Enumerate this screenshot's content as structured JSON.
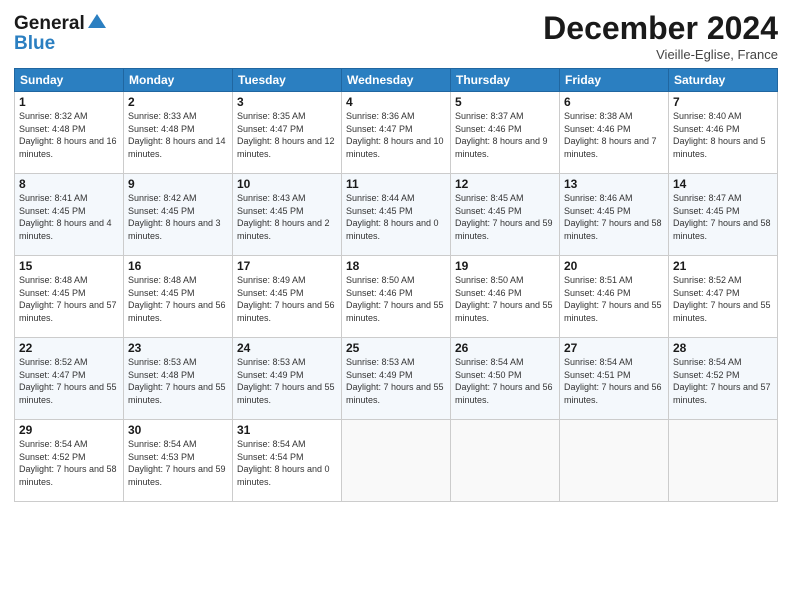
{
  "header": {
    "logo_general": "General",
    "logo_blue": "Blue",
    "month": "December 2024",
    "location": "Vieille-Eglise, France"
  },
  "days_of_week": [
    "Sunday",
    "Monday",
    "Tuesday",
    "Wednesday",
    "Thursday",
    "Friday",
    "Saturday"
  ],
  "weeks": [
    [
      {
        "day": "1",
        "sunrise": "8:32 AM",
        "sunset": "4:48 PM",
        "daylight": "8 hours and 16 minutes."
      },
      {
        "day": "2",
        "sunrise": "8:33 AM",
        "sunset": "4:48 PM",
        "daylight": "8 hours and 14 minutes."
      },
      {
        "day": "3",
        "sunrise": "8:35 AM",
        "sunset": "4:47 PM",
        "daylight": "8 hours and 12 minutes."
      },
      {
        "day": "4",
        "sunrise": "8:36 AM",
        "sunset": "4:47 PM",
        "daylight": "8 hours and 10 minutes."
      },
      {
        "day": "5",
        "sunrise": "8:37 AM",
        "sunset": "4:46 PM",
        "daylight": "8 hours and 9 minutes."
      },
      {
        "day": "6",
        "sunrise": "8:38 AM",
        "sunset": "4:46 PM",
        "daylight": "8 hours and 7 minutes."
      },
      {
        "day": "7",
        "sunrise": "8:40 AM",
        "sunset": "4:46 PM",
        "daylight": "8 hours and 5 minutes."
      }
    ],
    [
      {
        "day": "8",
        "sunrise": "8:41 AM",
        "sunset": "4:45 PM",
        "daylight": "8 hours and 4 minutes."
      },
      {
        "day": "9",
        "sunrise": "8:42 AM",
        "sunset": "4:45 PM",
        "daylight": "8 hours and 3 minutes."
      },
      {
        "day": "10",
        "sunrise": "8:43 AM",
        "sunset": "4:45 PM",
        "daylight": "8 hours and 2 minutes."
      },
      {
        "day": "11",
        "sunrise": "8:44 AM",
        "sunset": "4:45 PM",
        "daylight": "8 hours and 0 minutes."
      },
      {
        "day": "12",
        "sunrise": "8:45 AM",
        "sunset": "4:45 PM",
        "daylight": "7 hours and 59 minutes."
      },
      {
        "day": "13",
        "sunrise": "8:46 AM",
        "sunset": "4:45 PM",
        "daylight": "7 hours and 58 minutes."
      },
      {
        "day": "14",
        "sunrise": "8:47 AM",
        "sunset": "4:45 PM",
        "daylight": "7 hours and 58 minutes."
      }
    ],
    [
      {
        "day": "15",
        "sunrise": "8:48 AM",
        "sunset": "4:45 PM",
        "daylight": "7 hours and 57 minutes."
      },
      {
        "day": "16",
        "sunrise": "8:48 AM",
        "sunset": "4:45 PM",
        "daylight": "7 hours and 56 minutes."
      },
      {
        "day": "17",
        "sunrise": "8:49 AM",
        "sunset": "4:45 PM",
        "daylight": "7 hours and 56 minutes."
      },
      {
        "day": "18",
        "sunrise": "8:50 AM",
        "sunset": "4:46 PM",
        "daylight": "7 hours and 55 minutes."
      },
      {
        "day": "19",
        "sunrise": "8:50 AM",
        "sunset": "4:46 PM",
        "daylight": "7 hours and 55 minutes."
      },
      {
        "day": "20",
        "sunrise": "8:51 AM",
        "sunset": "4:46 PM",
        "daylight": "7 hours and 55 minutes."
      },
      {
        "day": "21",
        "sunrise": "8:52 AM",
        "sunset": "4:47 PM",
        "daylight": "7 hours and 55 minutes."
      }
    ],
    [
      {
        "day": "22",
        "sunrise": "8:52 AM",
        "sunset": "4:47 PM",
        "daylight": "7 hours and 55 minutes."
      },
      {
        "day": "23",
        "sunrise": "8:53 AM",
        "sunset": "4:48 PM",
        "daylight": "7 hours and 55 minutes."
      },
      {
        "day": "24",
        "sunrise": "8:53 AM",
        "sunset": "4:49 PM",
        "daylight": "7 hours and 55 minutes."
      },
      {
        "day": "25",
        "sunrise": "8:53 AM",
        "sunset": "4:49 PM",
        "daylight": "7 hours and 55 minutes."
      },
      {
        "day": "26",
        "sunrise": "8:54 AM",
        "sunset": "4:50 PM",
        "daylight": "7 hours and 56 minutes."
      },
      {
        "day": "27",
        "sunrise": "8:54 AM",
        "sunset": "4:51 PM",
        "daylight": "7 hours and 56 minutes."
      },
      {
        "day": "28",
        "sunrise": "8:54 AM",
        "sunset": "4:52 PM",
        "daylight": "7 hours and 57 minutes."
      }
    ],
    [
      {
        "day": "29",
        "sunrise": "8:54 AM",
        "sunset": "4:52 PM",
        "daylight": "7 hours and 58 minutes."
      },
      {
        "day": "30",
        "sunrise": "8:54 AM",
        "sunset": "4:53 PM",
        "daylight": "7 hours and 59 minutes."
      },
      {
        "day": "31",
        "sunrise": "8:54 AM",
        "sunset": "4:54 PM",
        "daylight": "8 hours and 0 minutes."
      },
      null,
      null,
      null,
      null
    ]
  ]
}
